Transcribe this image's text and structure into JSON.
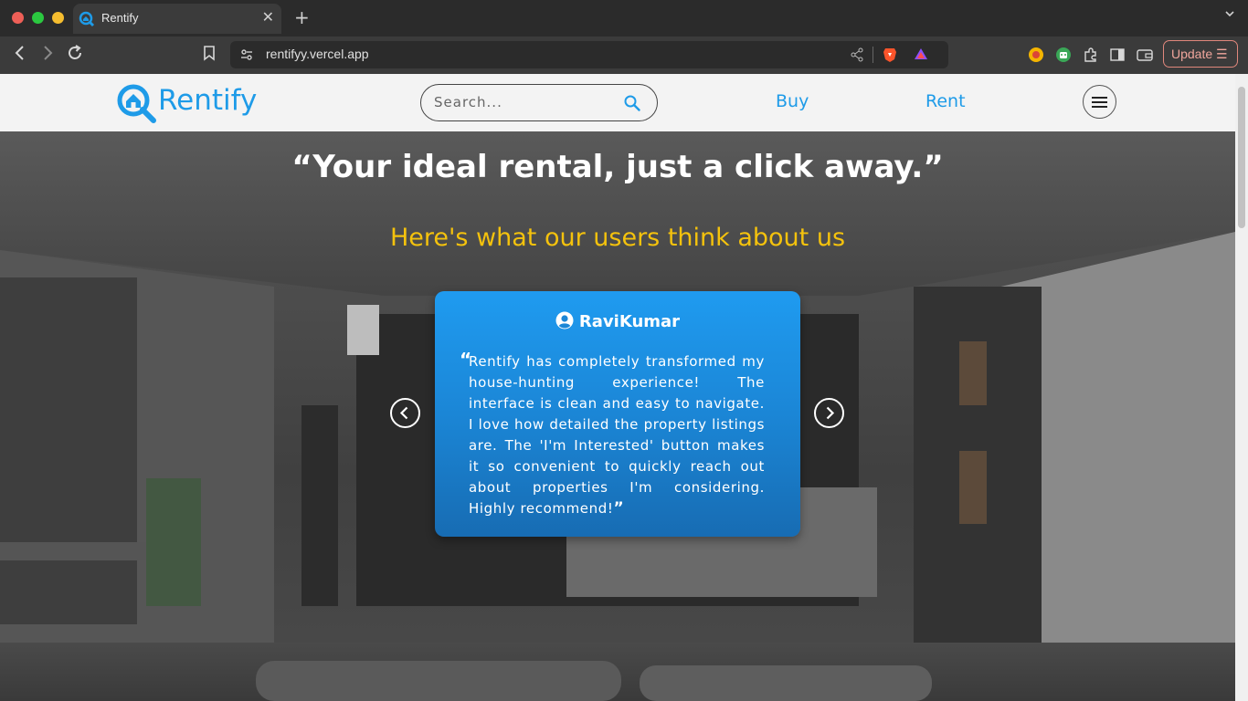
{
  "browser": {
    "tab_title": "Rentify",
    "tab_close": "✕",
    "new_tab": "+",
    "tab_menu": "⌄",
    "url": "rentifyy.vercel.app",
    "update_label": "Update ☰",
    "back": "‹",
    "forward": "›",
    "reload": "↻"
  },
  "header": {
    "logo_text": "Rentify",
    "search_placeholder": "Search...",
    "nav": {
      "buy": "Buy",
      "rent": "Rent"
    }
  },
  "hero": {
    "quote": "“Your ideal rental, just a click away.”",
    "subtitle": "Here's what our users think about us"
  },
  "testimonial": {
    "user": "RaviKumar",
    "open_quote": "“",
    "text": "Rentify has completely transformed my house-hunting experience! The interface is clean and easy to navigate. I love how detailed the property listings are. The 'I'm Interested' button makes it so convenient to quickly reach out about properties I'm considering. Highly recommend!",
    "close_quote": "”"
  },
  "colors": {
    "brand": "#1e9be8",
    "subtitle": "#f4c20d",
    "card": "#1b86d6"
  }
}
